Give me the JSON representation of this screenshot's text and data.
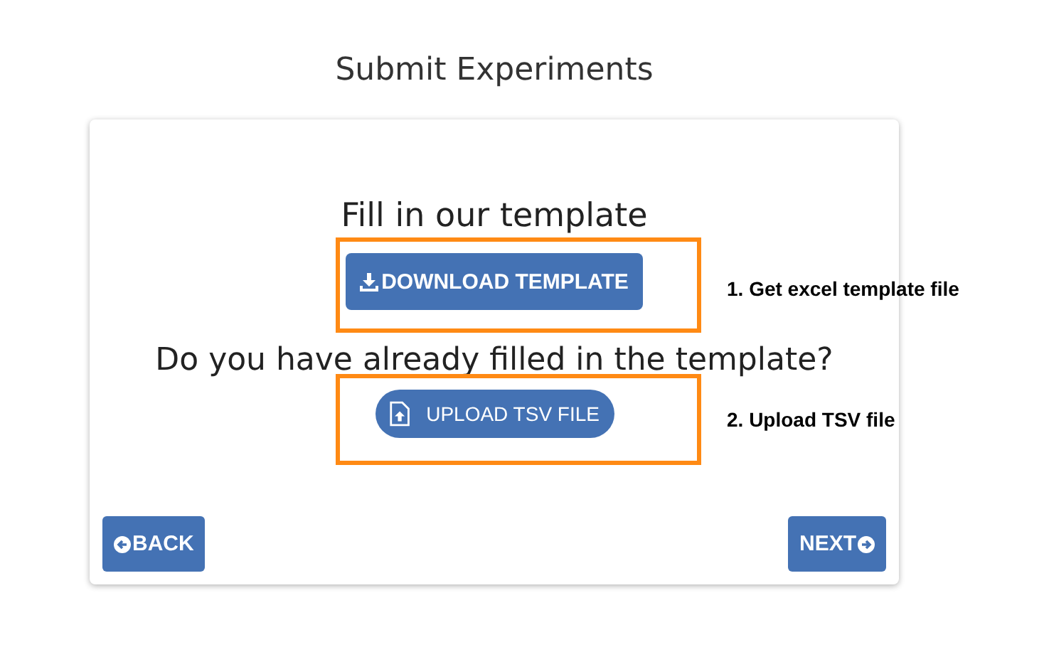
{
  "title": "Submit Experiments",
  "card": {
    "fill_heading": "Fill in our template",
    "download_button": "DOWNLOAD TEMPLATE",
    "question": "Do you have already filled in the template?",
    "upload_button": "UPLOAD TSV FILE",
    "back_button": "BACK",
    "next_button": "NEXT"
  },
  "annotations": [
    {
      "label": "1. Get excel template file"
    },
    {
      "label": "2. Upload TSV file"
    }
  ]
}
